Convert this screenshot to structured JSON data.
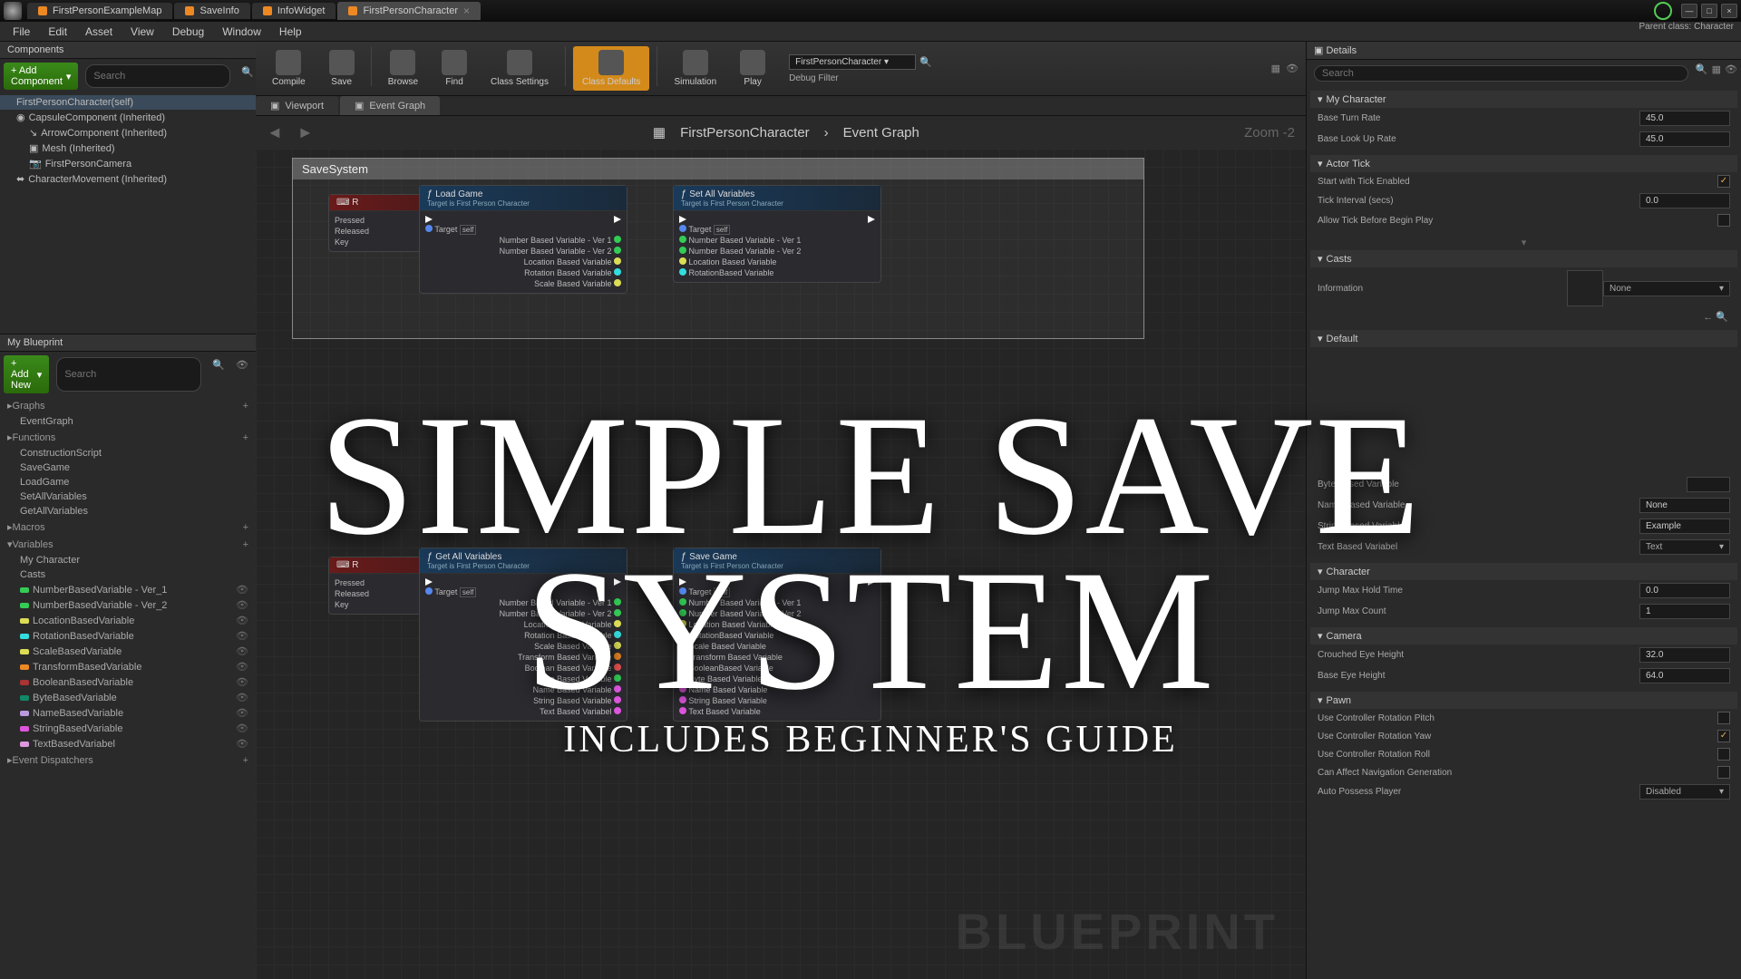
{
  "titlebar": {
    "tabs": [
      {
        "label": "FirstPersonExampleMap"
      },
      {
        "label": "SaveInfo"
      },
      {
        "label": "InfoWidget"
      },
      {
        "label": "FirstPersonCharacter",
        "active": true
      }
    ],
    "parent_class_label": "Parent class:",
    "parent_class": "Character"
  },
  "menubar": [
    "File",
    "Edit",
    "Asset",
    "View",
    "Debug",
    "Window",
    "Help"
  ],
  "components": {
    "title": "Components",
    "add_btn": "+ Add Component",
    "search_ph": "Search",
    "root": "FirstPersonCharacter(self)",
    "items": [
      "CapsuleComponent (Inherited)",
      "ArrowComponent (Inherited)",
      "Mesh (Inherited)",
      "FirstPersonCamera",
      "CharacterMovement (Inherited)"
    ]
  },
  "my_blueprint": {
    "title": "My Blueprint",
    "add_btn": "+ Add New",
    "sections": {
      "graphs": {
        "label": "Graphs",
        "items": [
          "EventGraph"
        ]
      },
      "functions": {
        "label": "Functions",
        "items": [
          "ConstructionScript",
          "SaveGame",
          "LoadGame",
          "SetAllVariables",
          "GetAllVariables"
        ]
      },
      "macros": {
        "label": "Macros"
      },
      "variables": {
        "label": "Variables",
        "groups": [
          {
            "label": "My Character"
          },
          {
            "label": "Casts"
          }
        ],
        "items": [
          {
            "label": "NumberBasedVariable - Ver_1",
            "color": "#3c5"
          },
          {
            "label": "NumberBasedVariable - Ver_2",
            "color": "#3c5"
          },
          {
            "label": "LocationBasedVariable",
            "color": "#dd5"
          },
          {
            "label": "RotationBasedVariable",
            "color": "#3dd"
          },
          {
            "label": "ScaleBasedVariable",
            "color": "#dd5"
          },
          {
            "label": "TransformBasedVariable",
            "color": "#e82"
          },
          {
            "label": "BooleanBasedVariable",
            "color": "#a33"
          },
          {
            "label": "ByteBasedVariable",
            "color": "#186"
          },
          {
            "label": "NameBasedVariable",
            "color": "#b9d"
          },
          {
            "label": "StringBasedVariable",
            "color": "#d5d"
          },
          {
            "label": "TextBasedVariabel",
            "color": "#d9d"
          }
        ]
      },
      "dispatchers": {
        "label": "Event Dispatchers"
      }
    }
  },
  "toolbar": {
    "items": [
      {
        "label": "Compile"
      },
      {
        "label": "Save"
      },
      {
        "label": "Browse"
      },
      {
        "label": "Find"
      },
      {
        "label": "Class Settings"
      },
      {
        "label": "Class Defaults",
        "active": true
      },
      {
        "label": "Simulation"
      },
      {
        "label": "Play"
      }
    ],
    "debug_select": "FirstPersonCharacter",
    "debug_label": "Debug Filter"
  },
  "graph_tabs": [
    {
      "label": "Viewport"
    },
    {
      "label": "Event Graph",
      "active": true
    }
  ],
  "breadcrumb": {
    "a": "FirstPersonCharacter",
    "b": "Event Graph",
    "zoom": "Zoom -2"
  },
  "graph": {
    "comment": "SaveSystem",
    "watermark": "BLUEPRINT",
    "input_node": {
      "key": "R",
      "pressed": "Pressed",
      "released": "Released",
      "keylabel": "Key"
    },
    "load_node": {
      "title": "Load Game",
      "sub": "Target is First Person Character",
      "target": "Target",
      "self": "self",
      "outs": [
        "Number Based Variable - Ver 1",
        "Number Based Variable - Ver 2",
        "Location Based Variable",
        "Rotation Based Variable",
        "Scale Based Variable"
      ]
    },
    "setall_node": {
      "title": "Set All Variables",
      "sub": "Target is First Person Character",
      "target": "Target",
      "self": "self",
      "ins": [
        "Number Based Variable - Ver 1",
        "Number Based Variable - Ver 2",
        "Location Based Variable",
        "RotationBased Variable"
      ]
    },
    "getall_node": {
      "title": "Get All Variables",
      "sub": "Target is First Person Character",
      "target": "Target",
      "self": "self",
      "outs": [
        "Number Based Variable - Ver 1",
        "Number Based Variable - Ver 2",
        "Location Based Variable",
        "Rotation Based Variable",
        "Scale Based Variable",
        "Transform Based Variable",
        "Boolean Based Variable",
        "Byte Based Variable",
        "Name Based Variable",
        "String Based Variable",
        "Text Based Variabel"
      ]
    },
    "save_node": {
      "title": "Save Game",
      "sub": "Target is First Person Character",
      "target": "Target",
      "self": "self",
      "ins": [
        "Number Based Variable - Ver 1",
        "Number Based Variable - Ver 2",
        "Location Based Variable",
        "RotationBased Variable",
        "Scale Based Variable",
        "Transform Based Variable",
        "BooleanBased Variable",
        "Byte Based Variable",
        "Name Based Variable",
        "String Based Variable",
        "Text Based Variable"
      ]
    }
  },
  "details": {
    "title": "Details",
    "search_ph": "Search",
    "my_character": {
      "label": "My Character",
      "base_turn": {
        "label": "Base Turn Rate",
        "val": "45.0"
      },
      "base_look": {
        "label": "Base Look Up Rate",
        "val": "45.0"
      }
    },
    "actor_tick": {
      "label": "Actor Tick",
      "start": {
        "label": "Start with Tick Enabled",
        "checked": true
      },
      "interval": {
        "label": "Tick Interval (secs)",
        "val": "0.0"
      },
      "allow": {
        "label": "Allow Tick Before Begin Play",
        "checked": false
      }
    },
    "casts": {
      "label": "Casts",
      "info": "Information",
      "none": "None"
    },
    "default": {
      "label": "Default",
      "byte": {
        "label": "Byte Based Variable"
      },
      "name": {
        "label": "Name Based Variable",
        "val": "None"
      },
      "string": {
        "label": "String Based Variable",
        "val": "Example"
      },
      "text": {
        "label": "Text Based Variabel",
        "val": "Text"
      }
    },
    "character": {
      "label": "Character",
      "jump_hold": {
        "label": "Jump Max Hold Time",
        "val": "0.0"
      },
      "jump_count": {
        "label": "Jump Max Count",
        "val": "1"
      }
    },
    "camera": {
      "label": "Camera",
      "crouch": {
        "label": "Crouched Eye Height",
        "val": "32.0"
      },
      "base": {
        "label": "Base Eye Height",
        "val": "64.0"
      }
    },
    "pawn": {
      "label": "Pawn",
      "pitch": {
        "label": "Use Controller Rotation Pitch",
        "checked": false
      },
      "yaw": {
        "label": "Use Controller Rotation Yaw",
        "checked": true
      },
      "roll": {
        "label": "Use Controller Rotation Roll",
        "checked": false
      },
      "nav": {
        "label": "Can Affect Navigation Generation",
        "checked": false
      },
      "possess": {
        "label": "Auto Possess Player",
        "val": "Disabled"
      }
    }
  },
  "overlay": {
    "title": "SIMPLE SAVE SYSTEM",
    "sub": "INCLUDES BEGINNER'S GUIDE"
  }
}
